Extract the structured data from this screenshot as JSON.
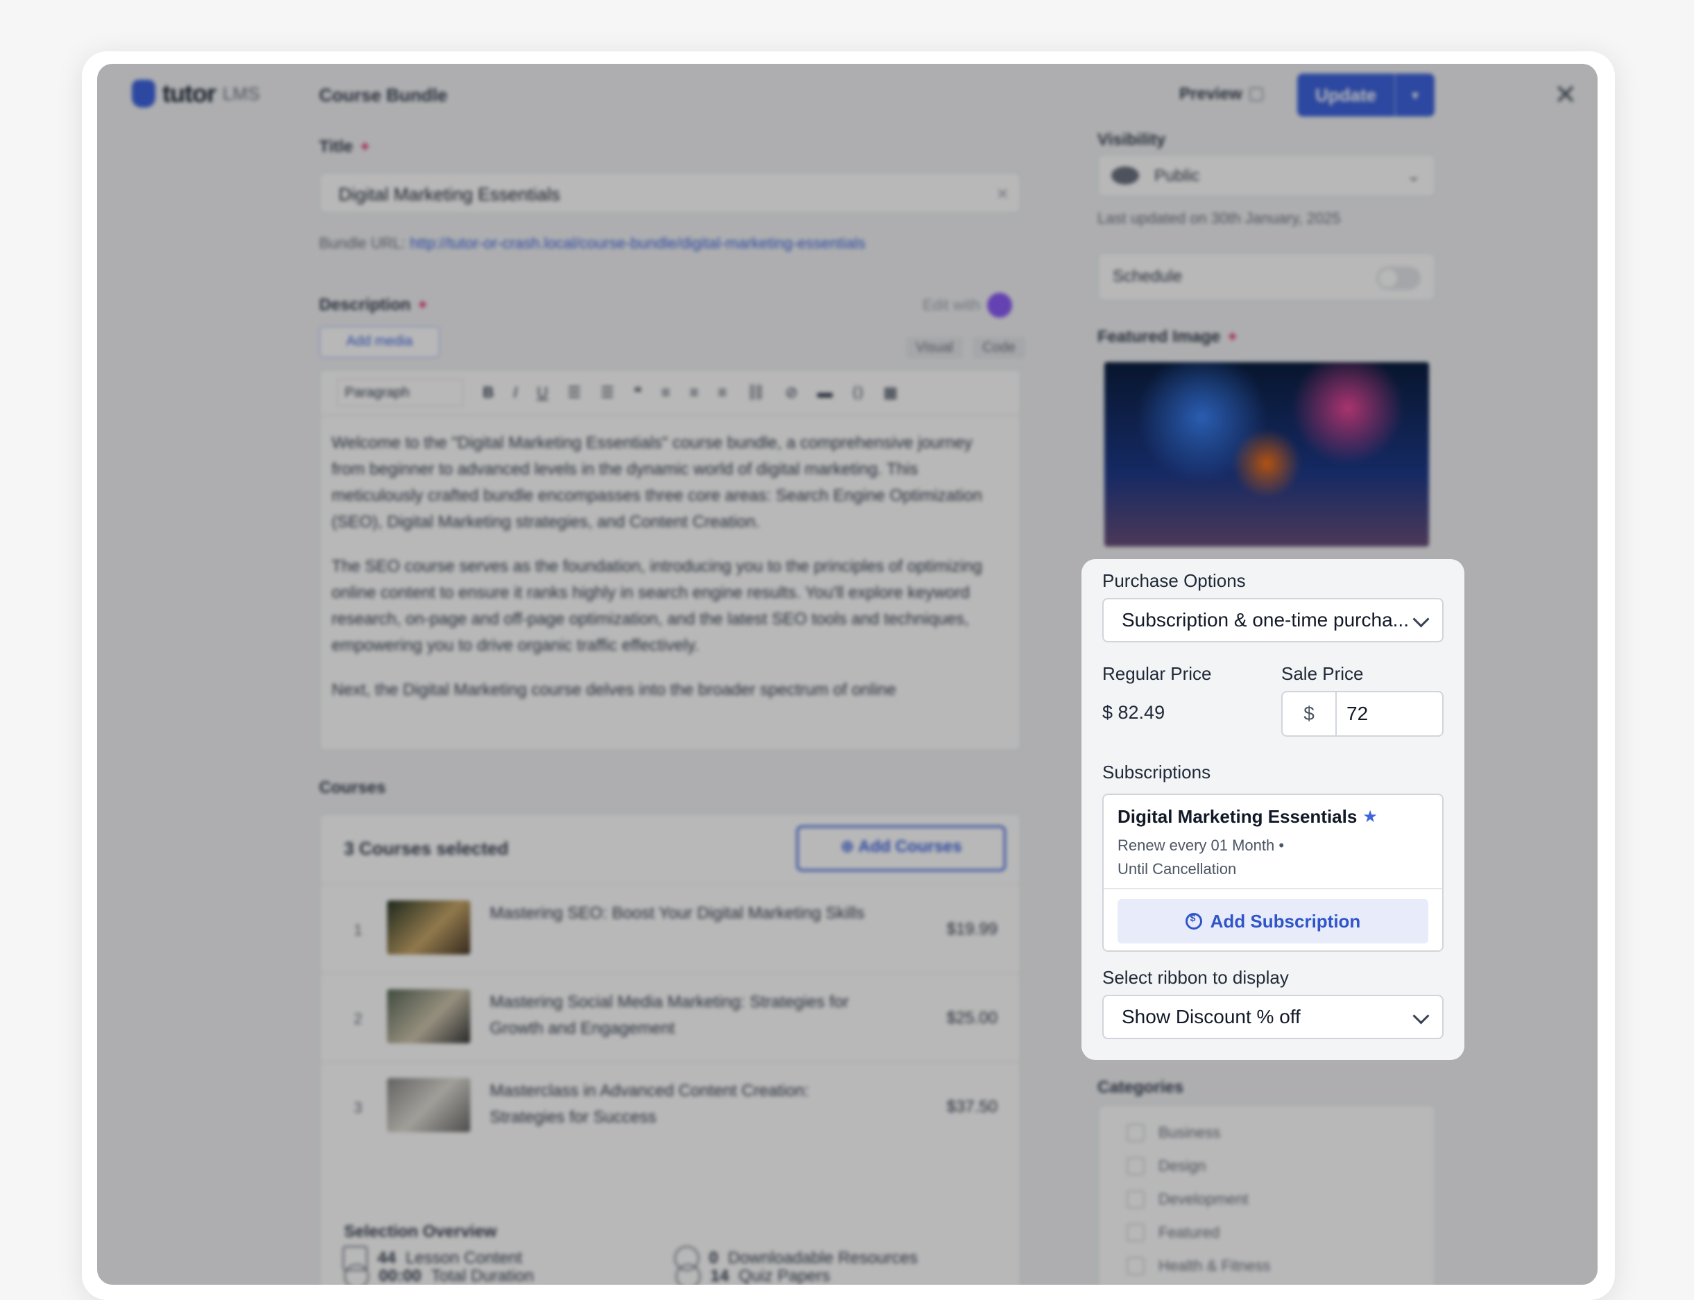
{
  "header": {
    "logo_text": "tutor",
    "logo_sub": "LMS",
    "title": "Course Bundle",
    "preview_label": "Preview",
    "update_label": "Update"
  },
  "title_field": {
    "label": "Title",
    "value": "Digital Marketing Essentials",
    "bundle_url_prefix": "Bundle URL:",
    "bundle_url": "http://tutor-or-crash.local/course-bundle/digital-marketing-essentials"
  },
  "description": {
    "label": "Description",
    "edit_with": "Edit with",
    "add_media": "Add media",
    "tab_visual": "Visual",
    "tab_code": "Code",
    "paragraph_select": "Paragraph",
    "paragraphs": [
      "Welcome to the \"Digital Marketing Essentials\" course bundle, a comprehensive journey from beginner to advanced levels in the dynamic world of digital marketing. This meticulously crafted bundle encompasses three core areas: Search Engine Optimization (SEO), Digital Marketing strategies, and Content Creation.",
      "The SEO course serves as the foundation, introducing you to the principles of optimizing online content to ensure it ranks highly in search engine results. You'll explore keyword research, on-page and off-page optimization, and the latest SEO tools and techniques, empowering you to drive organic traffic effectively.",
      "Next, the Digital Marketing course delves into the broader spectrum of online"
    ]
  },
  "courses": {
    "label": "Courses",
    "selected_text": "3 Courses selected",
    "add_button": "Add Courses",
    "items": [
      {
        "num": "1",
        "name": "Mastering SEO: Boost Your Digital Marketing Skills",
        "price": "$19.99"
      },
      {
        "num": "2",
        "name": "Mastering Social Media Marketing: Strategies for Growth and Engagement",
        "price": "$25.00"
      },
      {
        "num": "3",
        "name": "Masterclass in Advanced Content Creation: Strategies for Success",
        "price": "$37.50"
      }
    ],
    "overview_label": "Selection Overview",
    "overview": {
      "duration_value": "00:00",
      "duration_label": "Total Duration",
      "quiz_value": "14",
      "quiz_label": "Quiz Papers",
      "lesson_value": "44",
      "lesson_label": "Lesson Content",
      "resources_value": "0",
      "resources_label": "Downloadable Resources"
    }
  },
  "sidebar": {
    "visibility_label": "Visibility",
    "visibility_value": "Public",
    "last_updated": "Last updated on 30th January, 2025",
    "schedule_label": "Schedule",
    "featured_label": "Featured Image",
    "categories_label": "Categories",
    "categories": [
      "Business",
      "Design",
      "Development",
      "Featured",
      "Health & Fitness"
    ]
  },
  "purchase": {
    "label": "Purchase Options",
    "value": "Subscription & one-time purcha...",
    "regular_label": "Regular Price",
    "regular_value": "$ 82.49",
    "sale_label": "Sale Price",
    "sale_currency": "$",
    "sale_value": "72",
    "subscriptions_label": "Subscriptions",
    "subscription": {
      "title": "Digital Marketing Essentials",
      "renew": "Renew every 01 Month •",
      "until": "Until Cancellation"
    },
    "add_subscription": "Add Subscription",
    "ribbon_label": "Select ribbon to display",
    "ribbon_value": "Show Discount % off"
  }
}
